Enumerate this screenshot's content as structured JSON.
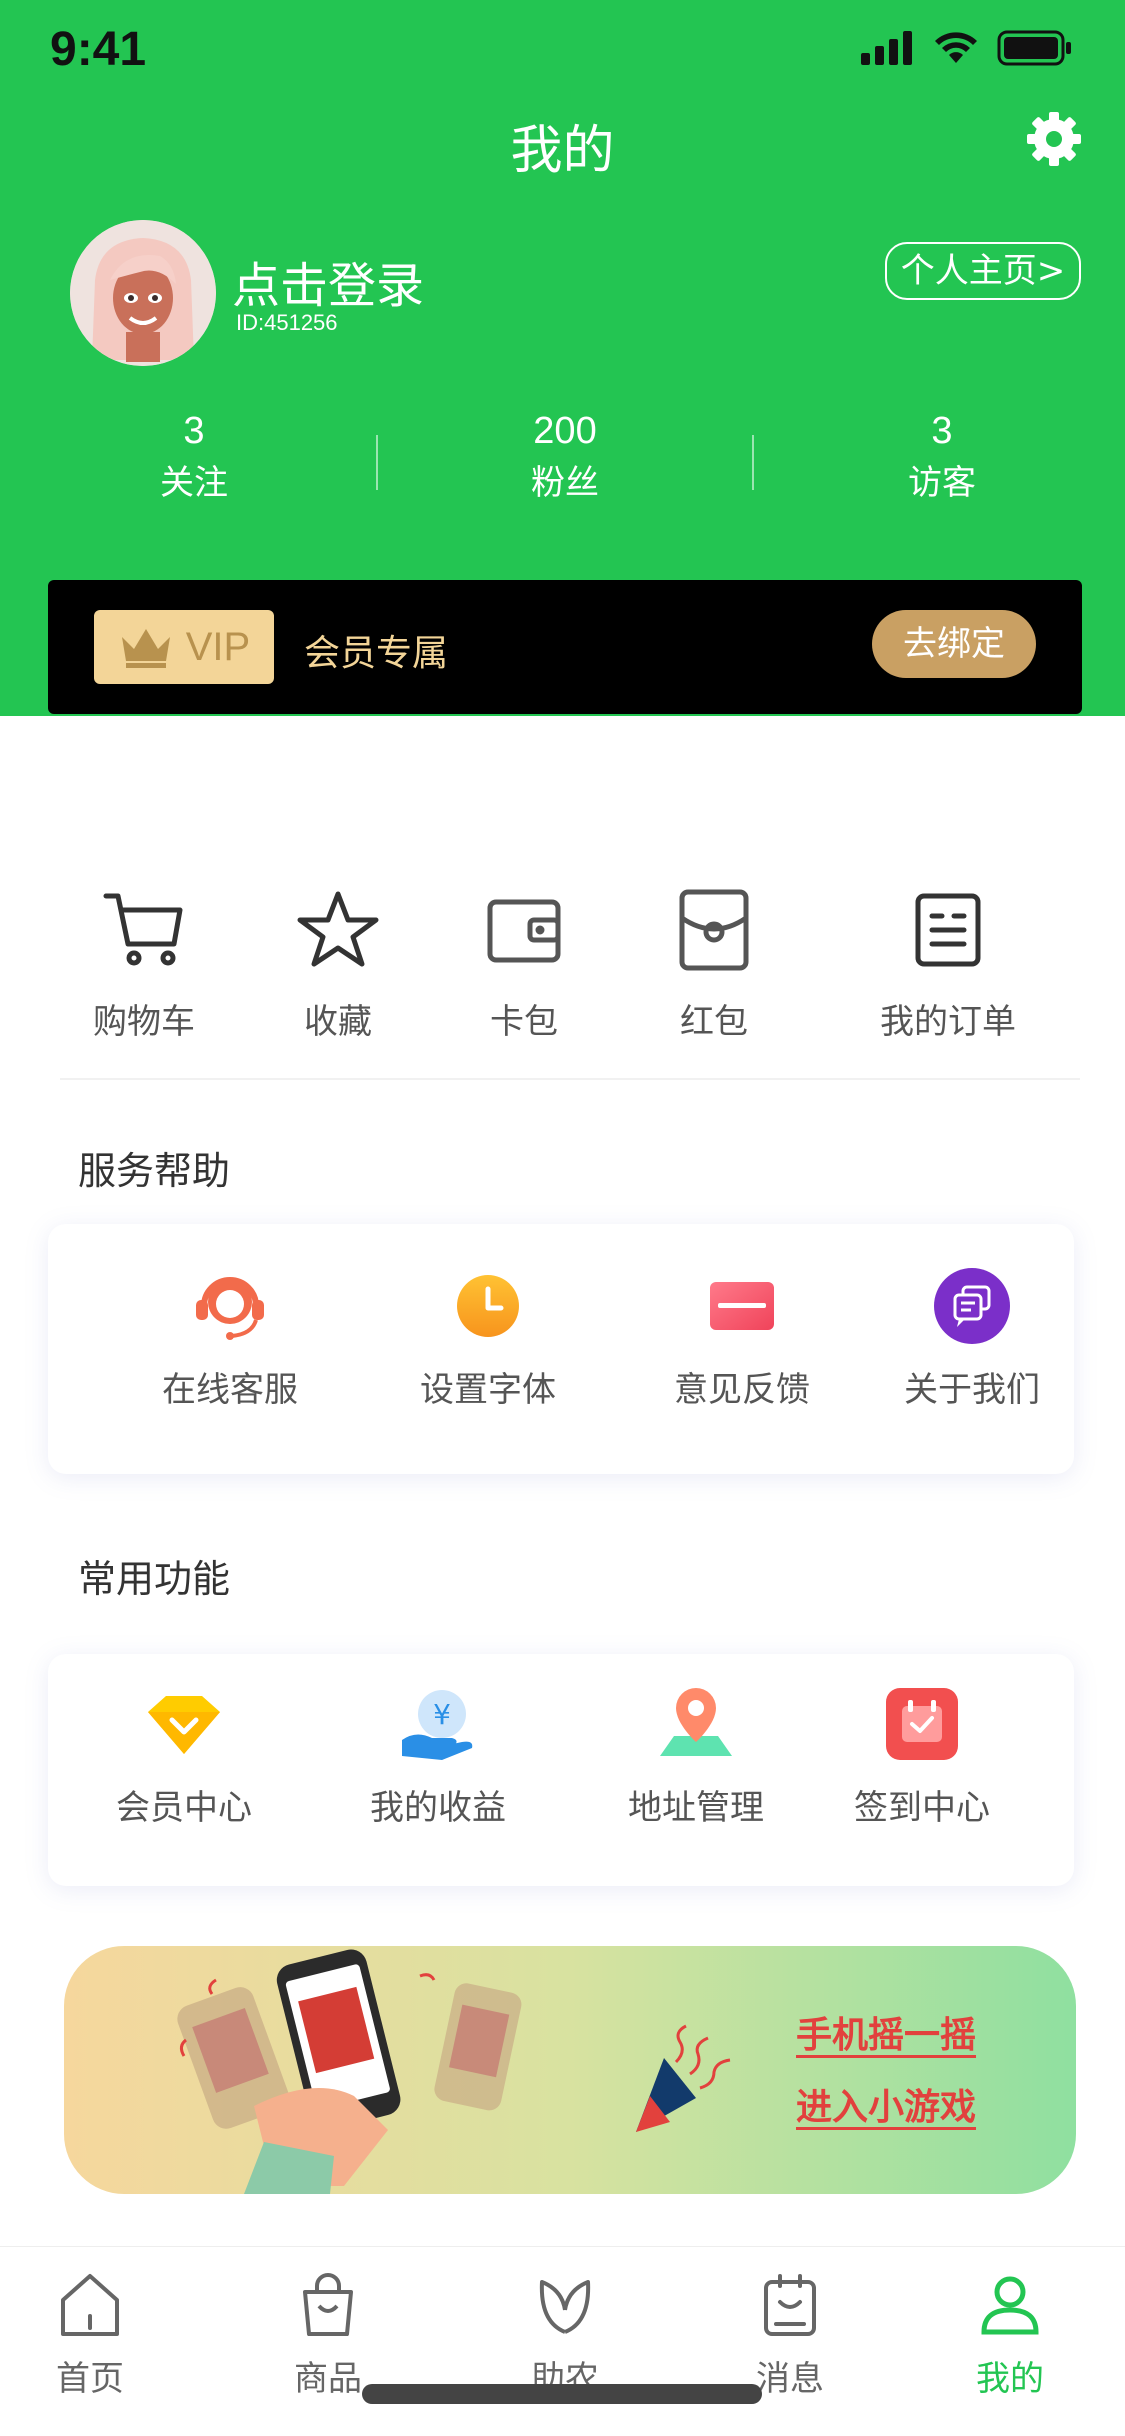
{
  "status": {
    "time": "9:41"
  },
  "header": {
    "title": "我的"
  },
  "user": {
    "login_text": "点击登录",
    "id_text": "ID:451256",
    "home_button": "个人主页>"
  },
  "stats": [
    {
      "value": "3",
      "label": "关注"
    },
    {
      "value": "200",
      "label": "粉丝"
    },
    {
      "value": "3",
      "label": "访客"
    }
  ],
  "vip": {
    "badge": "VIP",
    "text": "会员专属",
    "button": "去绑定"
  },
  "quick_actions": [
    "购物车",
    "收藏",
    "卡包",
    "红包",
    "我的订单"
  ],
  "service": {
    "title": "服务帮助",
    "items": [
      "在线客服",
      "设置字体",
      "意见反馈",
      "关于我们"
    ]
  },
  "common": {
    "title": "常用功能",
    "items": [
      "会员中心",
      "我的收益",
      "地址管理",
      "签到中心"
    ]
  },
  "banner": {
    "line1": "手机摇一摇",
    "line2": "进入小游戏"
  },
  "tabbar": [
    "首页",
    "商品",
    "助农",
    "消息",
    "我的"
  ],
  "colors": {
    "brand": "#23c552",
    "vip_gold": "#f3d598",
    "banner_text": "#e2413d"
  }
}
